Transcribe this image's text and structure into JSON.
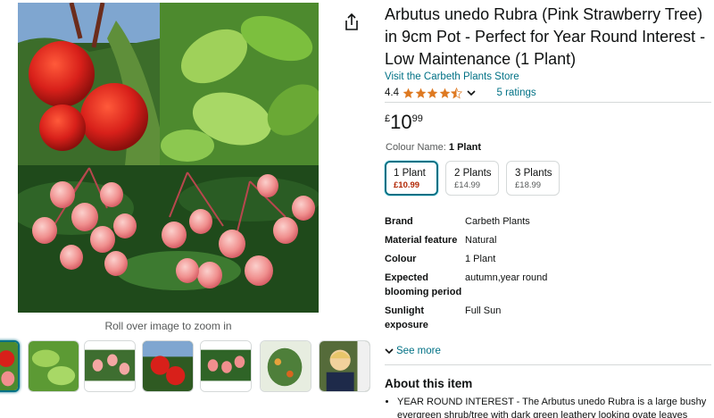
{
  "product": {
    "title": "Arbutus unedo Rubra (Pink Strawberry Tree) in 9cm Pot - Perfect for Year Round Interest - Low Maintenance (1 Plant)",
    "store_link": "Visit the Carbeth Plants Store",
    "rating_value": "4.4",
    "rating_fraction": 0.88,
    "ratings_count": "5 ratings",
    "price": {
      "currency": "£",
      "whole": "10",
      "fraction": "99"
    }
  },
  "gallery": {
    "zoom_hint": "Roll over image to zoom in",
    "thumbnail_count": 7,
    "selected_thumbnail": 0
  },
  "variants": {
    "label": "Colour Name:",
    "selected_name": "1 Plant",
    "options": [
      {
        "name": "1 Plant",
        "price": "£10.99"
      },
      {
        "name": "2 Plants",
        "price": "£14.99"
      },
      {
        "name": "3 Plants",
        "price": "£18.99"
      }
    ]
  },
  "specs": [
    {
      "key": "Brand",
      "value": "Carbeth Plants"
    },
    {
      "key": "Material feature",
      "value": "Natural"
    },
    {
      "key": "Colour",
      "value": "1 Plant"
    },
    {
      "key": "Expected blooming period",
      "value": "autumn,year round"
    },
    {
      "key": "Sunlight exposure",
      "value": "Full Sun"
    }
  ],
  "see_more": "See more",
  "about": {
    "title": "About this item",
    "bullets": [
      "YEAR ROUND INTEREST - The Arbutus unedo Rubra is a large bushy evergreen shrub/tree with dark green leathery looking ovate leaves"
    ]
  },
  "colors": {
    "link": "#007185",
    "star": "#de7921",
    "sale_price": "#b12704",
    "selected_border": "#007185"
  },
  "icons": [
    "share-icon",
    "star-icon",
    "chevron-down-icon"
  ]
}
